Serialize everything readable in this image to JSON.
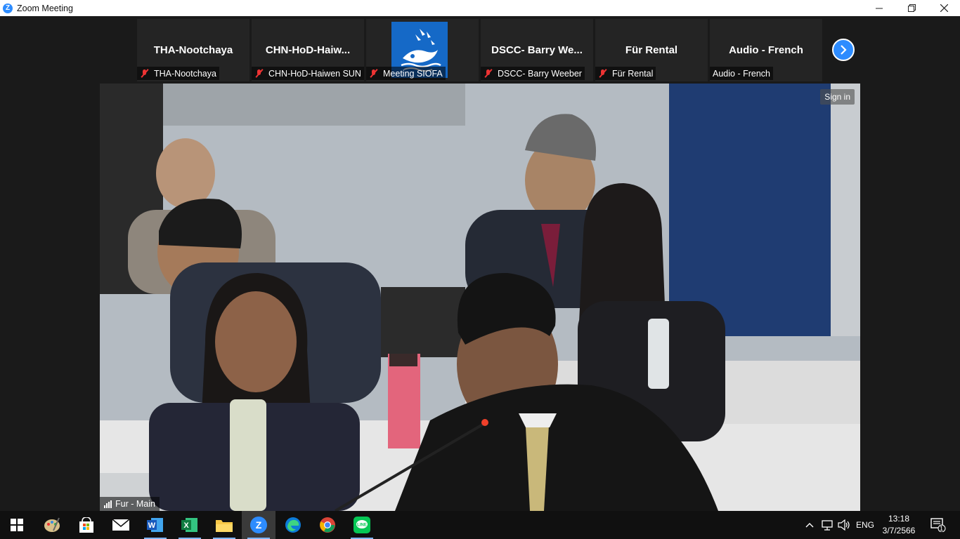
{
  "window": {
    "title": "Zoom Meeting",
    "app_icon_letter": "Z",
    "controls": [
      "minimize",
      "restore",
      "close"
    ]
  },
  "gallery": {
    "tiles": [
      {
        "name": "THA-Nootchaya",
        "label": "THA-Nootchaya",
        "muted": true
      },
      {
        "name": "CHN-HoD-Haiw...",
        "label": "CHN-HoD-Haiwen SUN",
        "muted": true
      },
      {
        "name": "",
        "label": "Meeting SIOFA",
        "muted": true,
        "has_logo": true
      },
      {
        "name": "DSCC- Barry We...",
        "label": "DSCC- Barry Weeber",
        "muted": true
      },
      {
        "name": "Für Rental",
        "label": "Für Rental",
        "muted": true
      },
      {
        "name": "Audio - French",
        "label": "Audio - French",
        "muted": false
      }
    ],
    "next_icon": "chevron-right-icon"
  },
  "main_video": {
    "sign_in": "Sign in",
    "speaker_label": "Fur - Main"
  },
  "taskbar": {
    "apps": [
      "start",
      "paint",
      "store",
      "mail",
      "word",
      "excel",
      "file-explorer",
      "zoom",
      "edge",
      "chrome",
      "line"
    ],
    "tray": {
      "language": "ENG",
      "time": "13:18",
      "date": "3/7/2566",
      "notification_count": "1"
    }
  },
  "colors": {
    "zoom_blue": "#2d8cff",
    "mute_red": "#e33333",
    "taskbar": "#101010"
  }
}
